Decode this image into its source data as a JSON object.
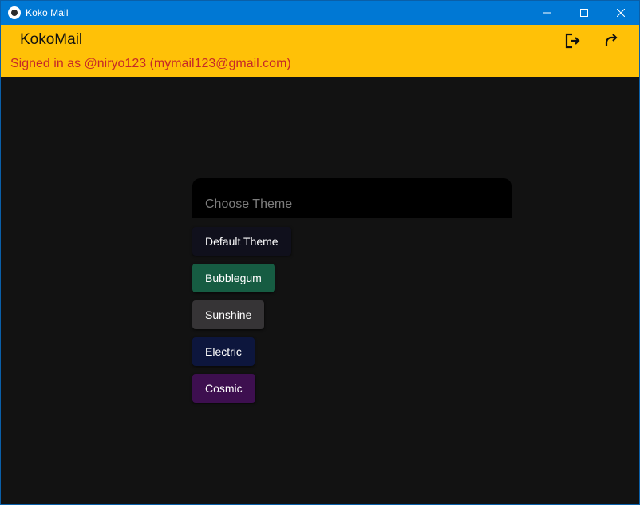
{
  "window": {
    "title": "Koko Mail",
    "controls": {
      "minimize": "minimize-icon",
      "maximize": "maximize-icon",
      "close": "close-icon"
    }
  },
  "header": {
    "app_name": "KokoMail",
    "signed_in_text": "Signed in as @niryo123 (mymail123@gmail.com)",
    "actions": [
      {
        "icon": "logout-icon"
      },
      {
        "icon": "refresh-icon"
      }
    ],
    "colors": {
      "background": "#ffc107",
      "signed_in_text": "#c62828"
    }
  },
  "theme_picker": {
    "title": "Choose Theme",
    "themes": [
      {
        "label": "Default Theme",
        "color": "#10101c"
      },
      {
        "label": "Bubblegum",
        "color": "#165c42"
      },
      {
        "label": "Sunshine",
        "color": "#363436"
      },
      {
        "label": "Electric",
        "color": "#0d163d"
      },
      {
        "label": "Cosmic",
        "color": "#3d0f4f"
      }
    ]
  }
}
